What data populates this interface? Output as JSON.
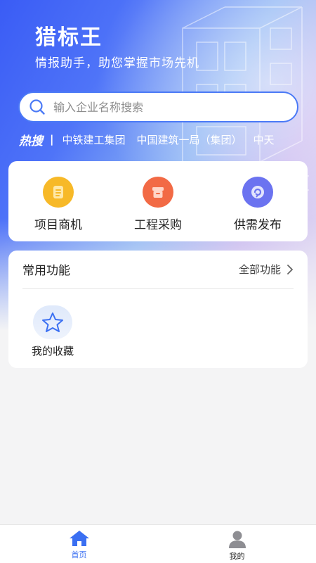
{
  "app": {
    "title": "猎标王",
    "subtitle": "情报助手，助您掌握市场先机"
  },
  "search": {
    "placeholder": "输入企业名称搜索"
  },
  "hot_search": {
    "label": "热搜",
    "items": [
      "中铁建工集团",
      "中国建筑一局（集团）",
      "中天"
    ]
  },
  "quick_actions": [
    {
      "label": "项目商机",
      "icon": "document-icon",
      "color": "#f7b928"
    },
    {
      "label": "工程采购",
      "icon": "box-icon",
      "color": "#f26a45"
    },
    {
      "label": "供需发布",
      "icon": "refresh-circle-icon",
      "color": "#6b73f0"
    }
  ],
  "common_functions": {
    "title": "常用功能",
    "all_label": "全部功能",
    "items": [
      {
        "label": "我的收藏",
        "icon": "star-icon"
      }
    ]
  },
  "tabbar": {
    "home_label": "首页",
    "mine_label": "我的",
    "active_color": "#3a6ff2"
  }
}
